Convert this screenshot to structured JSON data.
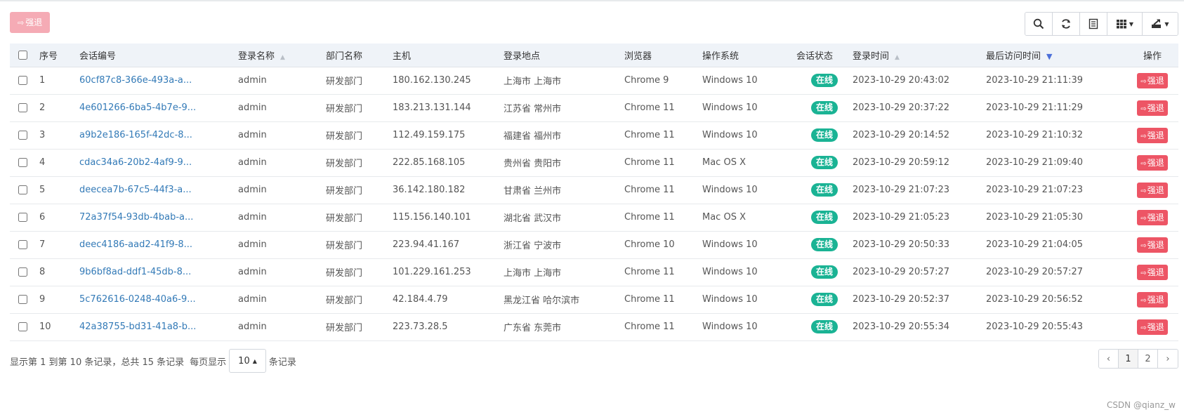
{
  "toolbar": {
    "force_label": "强退",
    "tools": [
      "search-icon",
      "refresh-icon",
      "list-icon",
      "columns-icon",
      "export-icon"
    ]
  },
  "table": {
    "headers": {
      "no": "序号",
      "session_id": "会话编号",
      "login_name": "登录名称",
      "dept": "部门名称",
      "host": "主机",
      "location": "登录地点",
      "browser": "浏览器",
      "os": "操作系统",
      "status": "会话状态",
      "login_time": "登录时间",
      "last_access": "最后访问时间",
      "action": "操作"
    },
    "rows": [
      {
        "no": "1",
        "session_id": "60cf87c8-366e-493a-a...",
        "login_name": "admin",
        "dept": "研发部门",
        "host": "180.162.130.245",
        "location": "上海市 上海市",
        "browser": "Chrome 9",
        "os": "Windows 10",
        "status": "在线",
        "login_time": "2023-10-29 20:43:02",
        "last_access": "2023-10-29 21:11:39",
        "action": "强退"
      },
      {
        "no": "2",
        "session_id": "4e601266-6ba5-4b7e-9...",
        "login_name": "admin",
        "dept": "研发部门",
        "host": "183.213.131.144",
        "location": "江苏省 常州市",
        "browser": "Chrome 11",
        "os": "Windows 10",
        "status": "在线",
        "login_time": "2023-10-29 20:37:22",
        "last_access": "2023-10-29 21:11:29",
        "action": "强退"
      },
      {
        "no": "3",
        "session_id": "a9b2e186-165f-42dc-8...",
        "login_name": "admin",
        "dept": "研发部门",
        "host": "112.49.159.175",
        "location": "福建省 福州市",
        "browser": "Chrome 11",
        "os": "Windows 10",
        "status": "在线",
        "login_time": "2023-10-29 20:14:52",
        "last_access": "2023-10-29 21:10:32",
        "action": "强退"
      },
      {
        "no": "4",
        "session_id": "cdac34a6-20b2-4af9-9...",
        "login_name": "admin",
        "dept": "研发部门",
        "host": "222.85.168.105",
        "location": "贵州省 贵阳市",
        "browser": "Chrome 11",
        "os": "Mac OS X",
        "status": "在线",
        "login_time": "2023-10-29 20:59:12",
        "last_access": "2023-10-29 21:09:40",
        "action": "强退"
      },
      {
        "no": "5",
        "session_id": "deecea7b-67c5-44f3-a...",
        "login_name": "admin",
        "dept": "研发部门",
        "host": "36.142.180.182",
        "location": "甘肃省 兰州市",
        "browser": "Chrome 11",
        "os": "Windows 10",
        "status": "在线",
        "login_time": "2023-10-29 21:07:23",
        "last_access": "2023-10-29 21:07:23",
        "action": "强退"
      },
      {
        "no": "6",
        "session_id": "72a37f54-93db-4bab-a...",
        "login_name": "admin",
        "dept": "研发部门",
        "host": "115.156.140.101",
        "location": "湖北省 武汉市",
        "browser": "Chrome 11",
        "os": "Mac OS X",
        "status": "在线",
        "login_time": "2023-10-29 21:05:23",
        "last_access": "2023-10-29 21:05:30",
        "action": "强退"
      },
      {
        "no": "7",
        "session_id": "deec4186-aad2-41f9-8...",
        "login_name": "admin",
        "dept": "研发部门",
        "host": "223.94.41.167",
        "location": "浙江省 宁波市",
        "browser": "Chrome 10",
        "os": "Windows 10",
        "status": "在线",
        "login_time": "2023-10-29 20:50:33",
        "last_access": "2023-10-29 21:04:05",
        "action": "强退"
      },
      {
        "no": "8",
        "session_id": "9b6bf8ad-ddf1-45db-8...",
        "login_name": "admin",
        "dept": "研发部门",
        "host": "101.229.161.253",
        "location": "上海市 上海市",
        "browser": "Chrome 11",
        "os": "Windows 10",
        "status": "在线",
        "login_time": "2023-10-29 20:57:27",
        "last_access": "2023-10-29 20:57:27",
        "action": "强退"
      },
      {
        "no": "9",
        "session_id": "5c762616-0248-40a6-9...",
        "login_name": "admin",
        "dept": "研发部门",
        "host": "42.184.4.79",
        "location": "黑龙江省 哈尔滨市",
        "browser": "Chrome 11",
        "os": "Windows 10",
        "status": "在线",
        "login_time": "2023-10-29 20:52:37",
        "last_access": "2023-10-29 20:56:52",
        "action": "强退"
      },
      {
        "no": "10",
        "session_id": "42a38755-bd31-41a8-b...",
        "login_name": "admin",
        "dept": "研发部门",
        "host": "223.73.28.5",
        "location": "广东省 东莞市",
        "browser": "Chrome 11",
        "os": "Windows 10",
        "status": "在线",
        "login_time": "2023-10-29 20:55:34",
        "last_access": "2023-10-29 20:55:43",
        "action": "强退"
      }
    ]
  },
  "pager": {
    "summary": "显示第 1 到第 10 条记录，总共 15 条记录",
    "per_page_prefix": "每页显示",
    "page_size": "10",
    "per_page_suffix": "条记录",
    "prev": "‹",
    "pages": [
      "1",
      "2"
    ],
    "current_page": "1",
    "next": "›"
  },
  "watermark": "CSDN @qianz_w",
  "colors": {
    "online_badge": "#1ab394",
    "force_button": "#ed5565",
    "force_button_disabled": "#f5a3ad",
    "link": "#337ab7",
    "header_bg": "#eff3f8"
  }
}
